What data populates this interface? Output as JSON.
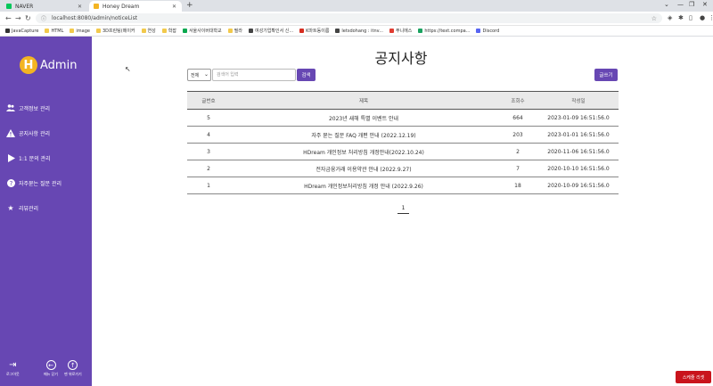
{
  "browser": {
    "tabs": [
      {
        "title": "NAVER",
        "favicon_color": "#03c75a",
        "active": false
      },
      {
        "title": "Honey Dream",
        "favicon_color": "#f3b422",
        "active": true
      }
    ],
    "url": "localhost:8080/admin/noticeList",
    "bookmarks": [
      {
        "label": "JavaCapture",
        "icon_color": "#333333"
      },
      {
        "label": "HTML",
        "icon_color": "#f2c94c"
      },
      {
        "label": "image",
        "icon_color": "#f2c94c"
      },
      {
        "label": "3D프린팅(메이커",
        "icon_color": "#f2c94c"
      },
      {
        "label": "연성",
        "icon_color": "#f2c94c"
      },
      {
        "label": "학잡",
        "icon_color": "#f2c94c"
      },
      {
        "label": "서울사이버대학교",
        "icon_color": "#0aa84f"
      },
      {
        "label": "필라",
        "icon_color": "#f2c94c"
      },
      {
        "label": "여성기업확인서 신...",
        "icon_color": "#444444"
      },
      {
        "label": "K마트동이름",
        "icon_color": "#d62d20"
      },
      {
        "label": "letsdohang : itnv...",
        "icon_color": "#444444"
      },
      {
        "label": "푸니에스",
        "icon_color": "#e03c31"
      },
      {
        "label": "https://text.compa...",
        "icon_color": "#1aa260"
      },
      {
        "label": "Discord",
        "icon_color": "#5865f2"
      }
    ]
  },
  "sidebar": {
    "logo_letter": "H",
    "logo_text": "Admin",
    "items": [
      {
        "label": "고객정보 관리",
        "icon": "users-icon"
      },
      {
        "label": "공지사항 관리",
        "icon": "warning-icon"
      },
      {
        "label": "1:1 문의 관리",
        "icon": "play-icon"
      },
      {
        "label": "자주묻는 질문 관리",
        "icon": "question-icon"
      },
      {
        "label": "리뷰관리",
        "icon": "star-icon"
      }
    ],
    "bottom": {
      "logout": "로그아웃",
      "menu_close": "메뉴 닫기",
      "scroll_top": "맨 위로가기"
    }
  },
  "main": {
    "title": "공지사항",
    "search": {
      "select_value": "전체",
      "placeholder": "검색어 입력",
      "button": "검색"
    },
    "write_button": "글쓰기",
    "table": {
      "headers": [
        "글번호",
        "제목",
        "조회수",
        "작성일"
      ],
      "rows": [
        {
          "no": "5",
          "title": "2023년 새해 특별 이벤트 안내",
          "views": "664",
          "date": "2023-01-09 16:51:56.0"
        },
        {
          "no": "4",
          "title": "자주 묻는 질문 FAQ 개편 안내 (2022.12.19)",
          "views": "203",
          "date": "2023-01-01 16:51:56.0"
        },
        {
          "no": "3",
          "title": "HDream 개인정보 처리방침 개정안내(2022.10.24)",
          "views": "2",
          "date": "2020-11-06 16:51:56.0"
        },
        {
          "no": "2",
          "title": "전자금융거래 이용약관 안내 (2022.9.27)",
          "views": "7",
          "date": "2020-10-10 16:51:56.0"
        },
        {
          "no": "1",
          "title": "HDream 개인정보처리방침 개정 안내 (2022.9.26)",
          "views": "18",
          "date": "2020-10-09 16:51:56.0"
        }
      ]
    },
    "pagination": {
      "current_page": "1"
    }
  },
  "floating": {
    "chat_button": "스케줄 리셋"
  },
  "colors": {
    "sidebar": "#6747b3",
    "accent": "#6747b3",
    "logo": "#f3b422",
    "chat": "#c9141c"
  }
}
